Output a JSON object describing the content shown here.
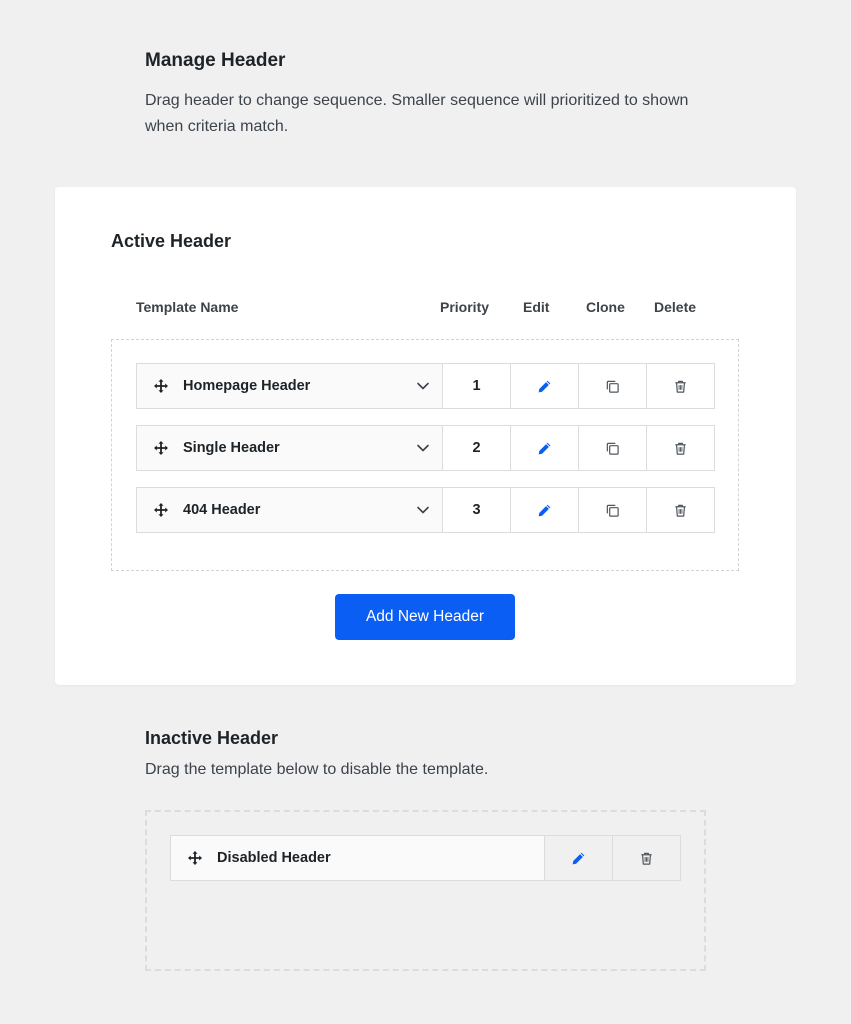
{
  "manage": {
    "title": "Manage Header",
    "description": "Drag header to change sequence. Smaller sequence will prioritized to shown when criteria match."
  },
  "active": {
    "title": "Active Header",
    "columns": {
      "template_name": "Template Name",
      "priority": "Priority",
      "edit": "Edit",
      "clone": "Clone",
      "delete": "Delete"
    },
    "rows": [
      {
        "name": "Homepage Header",
        "priority": "1"
      },
      {
        "name": "Single Header",
        "priority": "2"
      },
      {
        "name": "404 Header",
        "priority": "3"
      }
    ],
    "add_button": "Add New Header"
  },
  "inactive": {
    "title": "Inactive Header",
    "description": "Drag the template below to disable the template.",
    "rows": [
      {
        "name": "Disabled Header"
      }
    ]
  },
  "colors": {
    "accent": "#0b5ef4",
    "icon_gray": "#50575e",
    "background": "#f0f0f1"
  }
}
